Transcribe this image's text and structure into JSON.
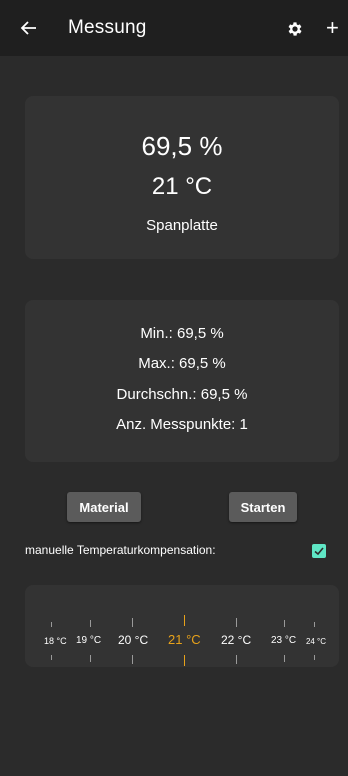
{
  "appbar": {
    "title": "Messung",
    "back_icon": "arrow-left-icon",
    "settings_icon": "gear-icon",
    "add_icon": "plus-icon"
  },
  "reading": {
    "moisture": "69,5 %",
    "temperature": "21 °C",
    "material": "Spanplatte"
  },
  "stats": {
    "min": "Min.: 69,5 %",
    "max": "Max.: 69,5 %",
    "avg": "Durchschn.: 69,5 %",
    "count": "Anz. Messpunkte: 1"
  },
  "buttons": {
    "material": "Material",
    "start": "Starten"
  },
  "compensation": {
    "label": "manuelle Temperaturkompensation:",
    "checked": true
  },
  "temp_picker": {
    "labels": [
      "18 °C",
      "19 °C",
      "20 °C",
      "21 °C",
      "22 °C",
      "23 °C",
      "24 °C"
    ],
    "selected": "21 °C",
    "selected_color": "#e8a21a"
  },
  "colors": {
    "accent": "#5fe6c5",
    "background": "#2b2b2b",
    "card": "#333333",
    "appbar": "#1f1f1f"
  }
}
